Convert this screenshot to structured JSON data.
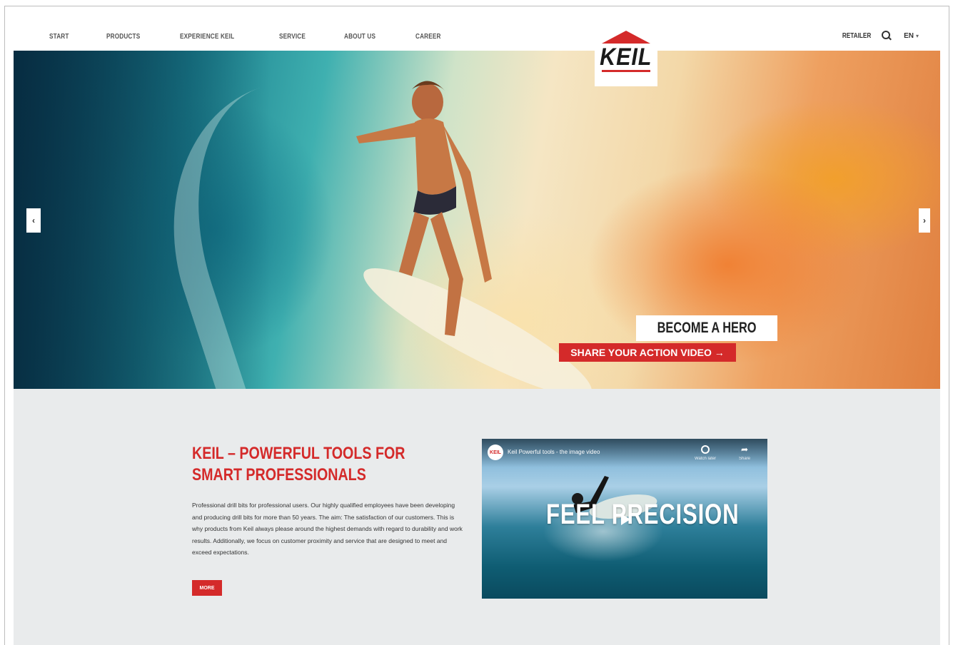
{
  "nav": {
    "items": [
      {
        "label": "START"
      },
      {
        "label": "PRODUCTS"
      },
      {
        "label": "EXPERIENCE KEIL"
      },
      {
        "label": "SERVICE"
      },
      {
        "label": "ABOUT US"
      },
      {
        "label": "CAREER"
      }
    ],
    "retailer_label": "RETAILER",
    "language": "EN",
    "search_icon": "search-icon",
    "language_icon": "chevron-down-icon"
  },
  "logo": {
    "text": "KEIL"
  },
  "hero": {
    "title": "BECOME A HERO",
    "cta_label": "SHARE YOUR ACTION VIDEO →",
    "prev_arrow": "‹",
    "next_arrow": "›"
  },
  "intro": {
    "headline": "KEIL – POWERFUL TOOLS FOR SMART PROFESSIONALS",
    "body": "Professional drill bits for professional users. Our highly qualified employees have been developing and producing drill bits for more than 50 years. The aim: The satisfaction of our customers. This is why products from Keil always please around the highest demands with regard to durability and work results. Additionally, we focus on customer proximity and service that are designed to meet and exceed expectations.",
    "more_label": "MORE"
  },
  "video": {
    "channel_avatar": "KEIL",
    "title": "Keil Powerful tools - the image video",
    "watch_later_label": "Watch later",
    "share_label": "Share",
    "overlay_text": "FEEL PRECISION"
  },
  "colors": {
    "accent": "#d42a2a",
    "section_bg": "#e9ebec"
  }
}
